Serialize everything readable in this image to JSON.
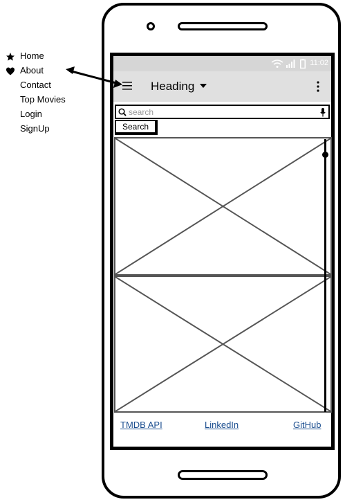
{
  "side_menu": {
    "items": [
      {
        "label": "Home",
        "icon": "star-icon"
      },
      {
        "label": "About",
        "icon": "heart-icon"
      },
      {
        "label": "Contact"
      },
      {
        "label": "Top Movies"
      },
      {
        "label": "Login"
      },
      {
        "label": "SignUp"
      }
    ]
  },
  "status_bar": {
    "time": "11:02"
  },
  "app_bar": {
    "title": "Heading"
  },
  "search": {
    "placeholder": "search",
    "button_label": "Search"
  },
  "footer": {
    "links": [
      {
        "label": "TMDB API"
      },
      {
        "label": "LinkedIn"
      },
      {
        "label": "GitHub"
      }
    ]
  },
  "colors": {
    "status_bar": "#d6d6d6",
    "app_bar": "#e0e0e0",
    "link": "#1a4d8f"
  }
}
